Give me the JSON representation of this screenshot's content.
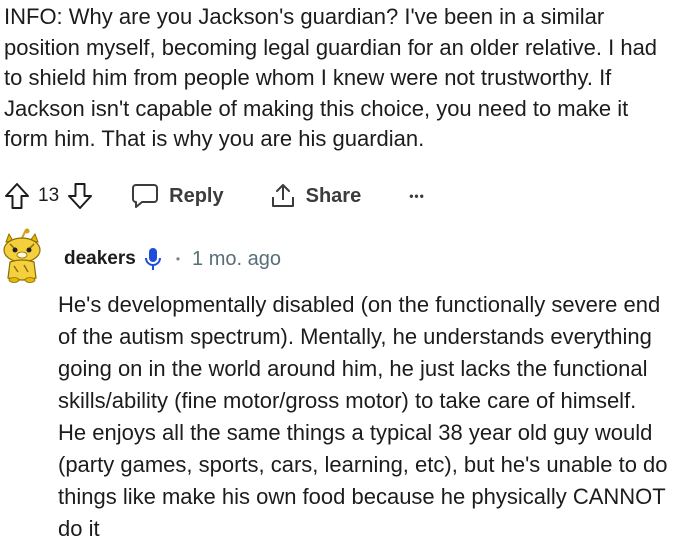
{
  "parent_comment": {
    "lines": [
      "INFO: Why are you Jackson's guardian? I've been in a similar",
      "position myself, becoming legal guardian for an older relative. I had",
      "to shield him from people whom I knew were not trustworthy. If",
      "Jackson isn't capable of making this choice, you need to make it",
      "form him. That is why you are his guardian."
    ]
  },
  "actions": {
    "vote_count": "13",
    "reply_label": "Reply",
    "share_label": "Share",
    "more_label": "•••"
  },
  "reply": {
    "username": "deakers",
    "separator": "•",
    "timestamp": "1 mo. ago",
    "lines": [
      "He's developmentally disabled (on the functionally severe end",
      "of the autism spectrum). Mentally, he understands everything",
      "going on in the world around him, he just lacks the functional",
      "skills/ability (fine motor/gross motor) to take care of himself.",
      "He enjoys all the same things a typical 38 year old guy would",
      "(party games, sports, cars, learning, etc), but he's unable to do",
      "things like make his own food because he physically CANNOT",
      "do it"
    ]
  },
  "icons": {
    "upvote": "upvote-arrow-icon",
    "downvote": "downvote-arrow-icon",
    "reply": "speech-bubble-icon",
    "share": "share-upload-icon",
    "mic": "microphone-icon",
    "avatar": "snoo-avatar"
  },
  "colors": {
    "text": "#1c1c1c",
    "muted": "#576f76",
    "mic_blue": "#1d4ed8",
    "avatar_yellow": "#f4d03f"
  }
}
